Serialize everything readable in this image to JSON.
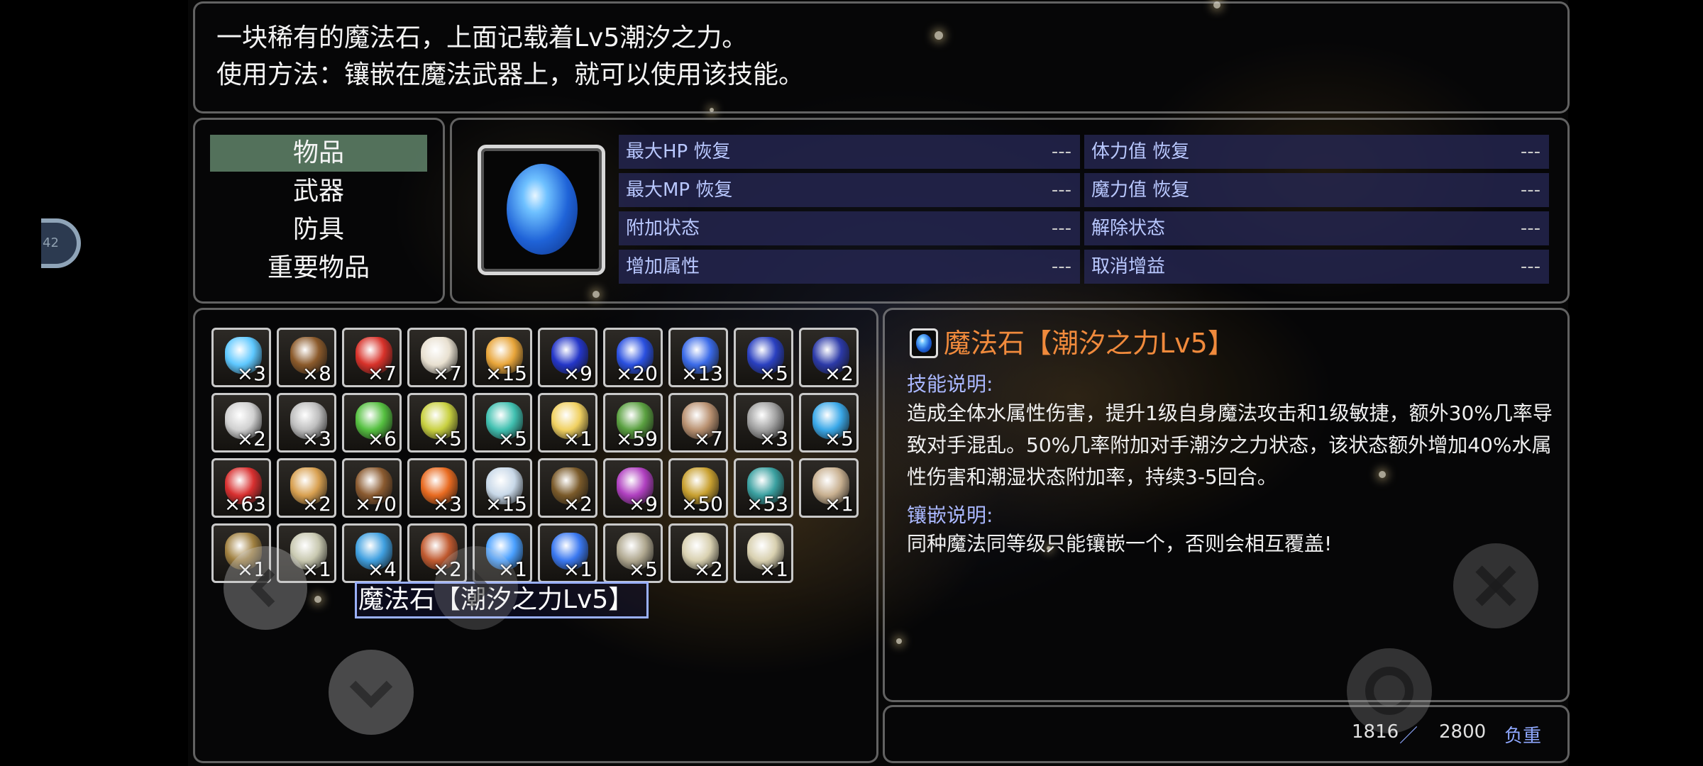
{
  "description": {
    "line1": "一块稀有的魔法石，上面记载着Lv5潮汐之力。",
    "line2": "使用方法：镶嵌在魔法武器上，就可以使用该技能。"
  },
  "side_badge": "42",
  "categories": [
    "物品",
    "武器",
    "防具",
    "重要物品"
  ],
  "selected_category": "物品",
  "stats": [
    {
      "label": "最大HP 恢复",
      "value": "---"
    },
    {
      "label": "体力值 恢复",
      "value": "---"
    },
    {
      "label": "最大MP 恢复",
      "value": "---"
    },
    {
      "label": "魔力值 恢复",
      "value": "---"
    },
    {
      "label": "附加状态",
      "value": "---"
    },
    {
      "label": "解除状态",
      "value": "---"
    },
    {
      "label": "增加属性",
      "value": "---"
    },
    {
      "label": "取消增益",
      "value": "---"
    }
  ],
  "inventory": [
    {
      "count": "×3",
      "color": "#5ec8ff"
    },
    {
      "count": "×8",
      "color": "#8b5a2b"
    },
    {
      "count": "×7",
      "color": "#d8322a"
    },
    {
      "count": "×7",
      "color": "#e8e0d0"
    },
    {
      "count": "×15",
      "color": "#e8a53a"
    },
    {
      "count": "×9",
      "color": "#2436c8"
    },
    {
      "count": "×20",
      "color": "#2a50e0"
    },
    {
      "count": "×13",
      "color": "#3a6ae8"
    },
    {
      "count": "×5",
      "color": "#2a40c0"
    },
    {
      "count": "×2",
      "color": "#2c3aa8"
    },
    {
      "count": "×2",
      "color": "#d0d0d0"
    },
    {
      "count": "×3",
      "color": "#bdbdbd"
    },
    {
      "count": "×6",
      "color": "#55c040"
    },
    {
      "count": "×5",
      "color": "#c8d040"
    },
    {
      "count": "×5",
      "color": "#40c0b0"
    },
    {
      "count": "×1",
      "color": "#f0d060"
    },
    {
      "count": "×59",
      "color": "#5aa040"
    },
    {
      "count": "×7",
      "color": "#b89070"
    },
    {
      "count": "×3",
      "color": "#a0a0a0"
    },
    {
      "count": "×5",
      "color": "#3aa8e8"
    },
    {
      "count": "×63",
      "color": "#d83030"
    },
    {
      "count": "×2",
      "color": "#d8a050"
    },
    {
      "count": "×70",
      "color": "#8a5a30"
    },
    {
      "count": "×3",
      "color": "#e86a20"
    },
    {
      "count": "×15",
      "color": "#c8d8e8"
    },
    {
      "count": "×2",
      "color": "#7a5a2a"
    },
    {
      "count": "×9",
      "color": "#b040c0"
    },
    {
      "count": "×50",
      "color": "#c8a030"
    },
    {
      "count": "×53",
      "color": "#3aa0a0"
    },
    {
      "count": "×1",
      "color": "#c8b090"
    },
    {
      "count": "×1",
      "color": "#a08040"
    },
    {
      "count": "×1",
      "color": "#c8c8b0"
    },
    {
      "count": "×4",
      "color": "#40a0e0"
    },
    {
      "count": "×2",
      "color": "#c05a30"
    },
    {
      "count": "×1",
      "color": "#4aa0ff"
    },
    {
      "count": "×1",
      "color": "#3a78f0"
    },
    {
      "count": "×5",
      "color": "#b0a890"
    },
    {
      "count": "×2",
      "color": "#d8d0b0"
    },
    {
      "count": "×1",
      "color": "#d8d0b0"
    }
  ],
  "selected_item_name": "魔法石【潮汐之力Lv5】",
  "detail": {
    "title": "魔法石【潮汐之力Lv5】",
    "skill_heading": "技能说明:",
    "skill_text": "造成全体水属性伤害，提升1级自身魔法攻击和1级敏捷，额外30%几率导致对手混乱。50%几率附加对手潮汐之力状态，该状态额外增加40%水属性伤害和潮湿状态附加率，持续3-5回合。",
    "inlay_heading": "镶嵌说明:",
    "inlay_text": "同种魔法同等级只能镶嵌一个，否则会相互覆盖!"
  },
  "weight": {
    "current": "1816",
    "separator": "／",
    "max": "2800",
    "label": "负重"
  },
  "colors": {
    "accent_title": "#f08a3c",
    "stat_label": "#b9c8ff",
    "selection": "#6e9678"
  }
}
